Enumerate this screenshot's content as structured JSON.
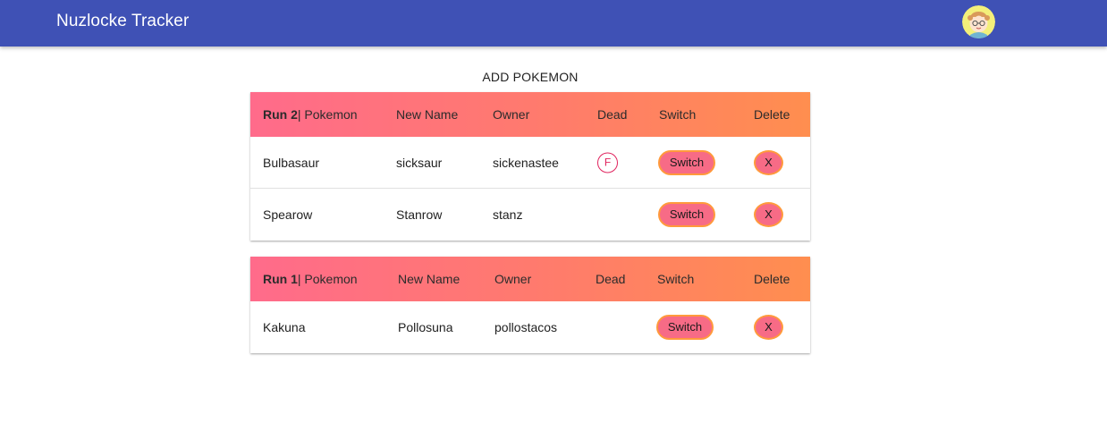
{
  "app": {
    "title": "Nuzlocke Tracker",
    "avatar_icon": "user-avatar-icon"
  },
  "actions": {
    "add_pokemon": "ADD POKEMON"
  },
  "colors": {
    "appbar": "#3f51b5",
    "header_gradient_start": "#ff6b8b",
    "header_gradient_end": "#ff8e4f",
    "button_fill": "#f76b86",
    "button_border": "#ff9a3c",
    "dead_badge": "#e0245e"
  },
  "runs": [
    {
      "run_label": "Run 2",
      "headers": {
        "pokemon": "| Pokemon",
        "new_name": "New Name",
        "owner": "Owner",
        "dead": "Dead",
        "switch": "Switch",
        "delete": "Delete"
      },
      "rows": [
        {
          "pokemon": "Bulbasaur",
          "new_name": "sicksaur",
          "owner": "sickenastee",
          "dead": "F",
          "switch_label": "Switch",
          "delete_label": "X"
        },
        {
          "pokemon": "Spearow",
          "new_name": "Stanrow",
          "owner": "stanz",
          "dead": "",
          "switch_label": "Switch",
          "delete_label": "X"
        }
      ]
    },
    {
      "run_label": "Run 1",
      "headers": {
        "pokemon": "| Pokemon",
        "new_name": "New Name",
        "owner": "Owner",
        "dead": "Dead",
        "switch": "Switch",
        "delete": "Delete"
      },
      "rows": [
        {
          "pokemon": "Kakuna",
          "new_name": "Pollosuna",
          "owner": "pollostacos",
          "dead": "",
          "switch_label": "Switch",
          "delete_label": "X"
        }
      ]
    }
  ]
}
